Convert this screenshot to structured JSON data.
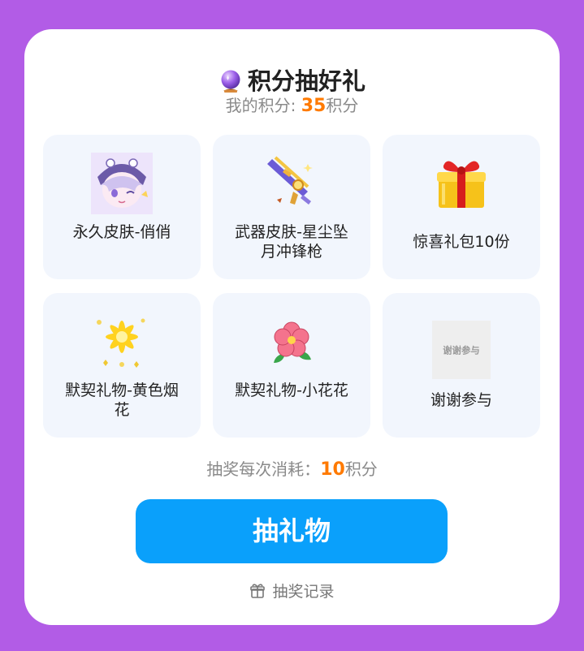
{
  "header": {
    "title": "积分抽好礼",
    "title_icon": "crystal-ball-icon"
  },
  "points": {
    "label": "我的积分: ",
    "value": "35",
    "unit": "积分"
  },
  "prizes": [
    {
      "name": "永久皮肤-俏俏",
      "icon": "character-skin-image"
    },
    {
      "name": "武器皮肤-星尘坠月冲锋枪",
      "icon": "weapon-skin-image"
    },
    {
      "name": "惊喜礼包10份",
      "icon": "gift-box-image"
    },
    {
      "name": "默契礼物-黄色烟花",
      "icon": "yellow-firework-image"
    },
    {
      "name": "默契礼物-小花花",
      "icon": "pink-flower-image"
    },
    {
      "name": "谢谢参与",
      "icon": "thanks-image",
      "image_text": "谢谢参与"
    }
  ],
  "cost": {
    "label": "抽奖每次消耗：",
    "value": "10",
    "unit": "积分"
  },
  "draw_button": {
    "label": "抽礼物"
  },
  "record_link": {
    "label": "抽奖记录",
    "icon": "gift-outline-icon"
  },
  "colors": {
    "background": "#b25ce6",
    "accent": "#ff7a00",
    "button": "#0aa0fb",
    "cell": "#f2f6fd"
  }
}
